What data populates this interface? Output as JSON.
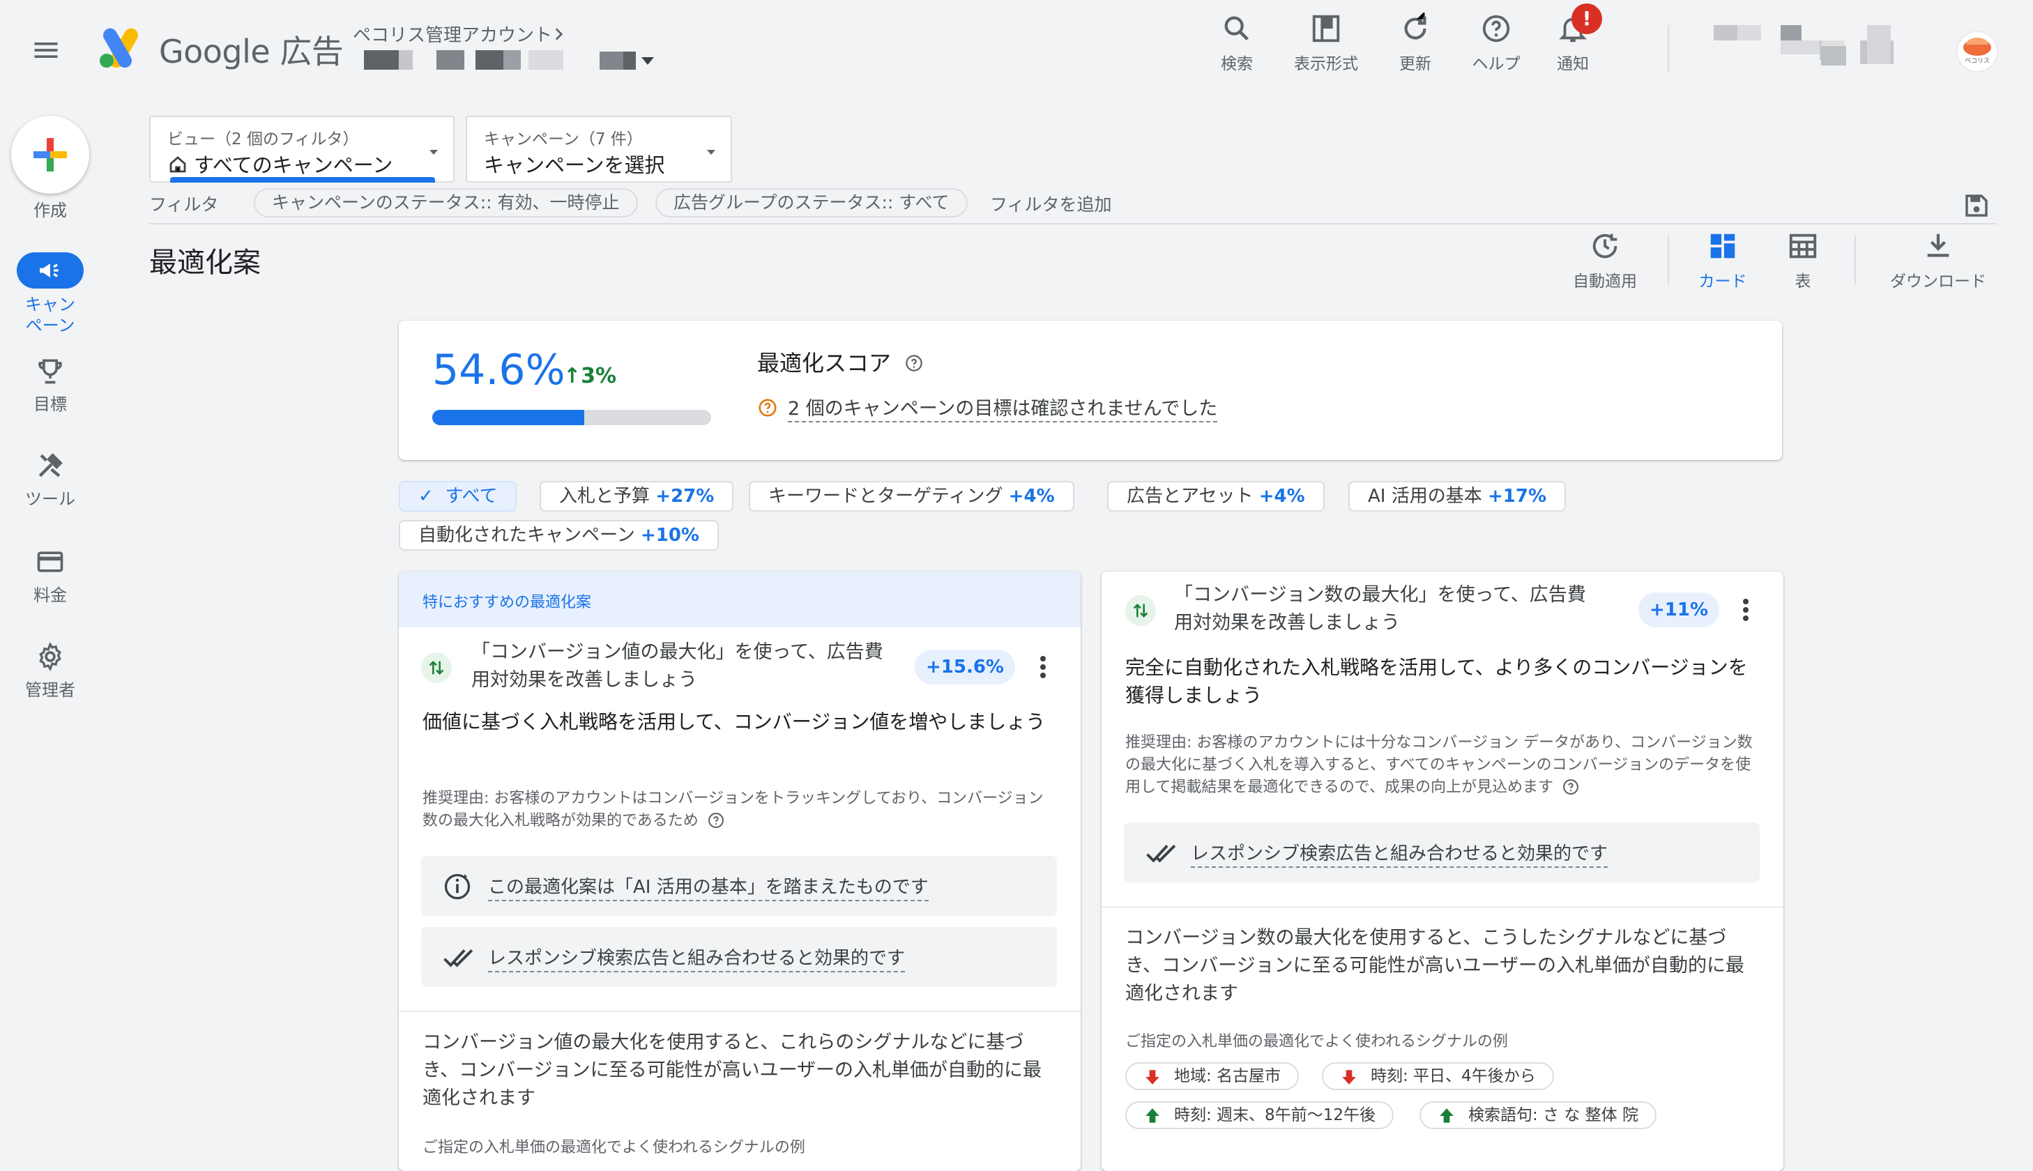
{
  "header": {
    "brand": "Google 広告",
    "account_label": "ペコリス管理アカウント",
    "tools": [
      {
        "label": "検索",
        "icon": "search-icon"
      },
      {
        "label": "表示形式",
        "icon": "appearance-icon"
      },
      {
        "label": "更新",
        "icon": "refresh-icon"
      },
      {
        "label": "ヘルプ",
        "icon": "help-icon"
      },
      {
        "label": "通知",
        "icon": "bell-icon"
      }
    ],
    "notification_badge": "!",
    "avatar_text": "ペコリス"
  },
  "sidebar": {
    "create_label": "作成",
    "items": [
      {
        "label": "キャンペーン",
        "icon": "megaphone-icon"
      },
      {
        "label": "目標",
        "icon": "trophy-icon"
      },
      {
        "label": "ツール",
        "icon": "tools-icon"
      },
      {
        "label": "料金",
        "icon": "credit-card-icon"
      },
      {
        "label": "管理者",
        "icon": "gear-icon"
      }
    ]
  },
  "selectors": {
    "view": {
      "label": "ビュー（2 個のフィルタ）",
      "value": "すべてのキャンペーン"
    },
    "campaign": {
      "label": "キャンペーン（7 件）",
      "value": "キャンペーンを選択"
    }
  },
  "filters": {
    "label": "フィルタ",
    "chips": [
      "キャンペーンのステータス:: 有効、一時停止",
      "広告グループのステータス:: すべて"
    ],
    "add": "フィルタを追加"
  },
  "page": {
    "title": "最適化案",
    "view_tools": [
      {
        "label": "自動適用",
        "icon": "auto-apply-icon"
      },
      {
        "label": "カード",
        "icon": "cards-icon"
      },
      {
        "label": "表",
        "icon": "table-icon"
      },
      {
        "label": "ダウンロード",
        "icon": "download-icon"
      }
    ]
  },
  "score": {
    "value": "54.6%",
    "delta": "3%",
    "progress": 0.546,
    "title": "最適化スコア",
    "note": "2 個のキャンペーンの目標は確認されませんでした"
  },
  "categories": [
    {
      "label": "すべて",
      "value": ""
    },
    {
      "label": "入札と予算",
      "value": "+27%"
    },
    {
      "label": "キーワードとターゲティング",
      "value": "+4%"
    },
    {
      "label": "広告とアセット",
      "value": "+4%"
    },
    {
      "label": "AI 活用の基本",
      "value": "+17%"
    },
    {
      "label": "自動化されたキャンペーン",
      "value": "+10%"
    }
  ],
  "cards": [
    {
      "featured": "特におすすめの最適化案",
      "title": "「コンバージョン値の最大化」を使って、広告費用対効果を改善しましょう",
      "badge": "+15.6%",
      "description": "価値に基づく入札戦略を活用して、コンバージョン値を増やしましょう",
      "reason": "推奨理由: お客様のアカウントはコンバージョンをトラッキングしており、コンバージョン数の最大化入札戦略が効果的であるため",
      "box1": "この最適化案は「AI 活用の基本」を踏まえたものです",
      "box2": "レスポンシブ検索広告と組み合わせると効果的です",
      "body": "コンバージョン値の最大化を使用すると、これらのシグナルなどに基づき、コンバージョンに至る可能性が高いユーザーの入札単価が自動的に最適化されます",
      "signals_label": "ご指定の入札単価の最適化でよく使われるシグナルの例"
    },
    {
      "title": "「コンバージョン数の最大化」を使って、広告費用対効果を改善しましょう",
      "badge": "+11%",
      "description": "完全に自動化された入札戦略を活用して、より多くのコンバージョンを獲得しましょう",
      "reason": "推奨理由: お客様のアカウントには十分なコンバージョン データがあり、コンバージョン数の最大化に基づく入札を導入すると、すべてのキャンペーンのコンバージョンのデータを使用して掲載結果を最適化できるので、成果の向上が見込めます",
      "box2": "レスポンシブ検索広告と組み合わせると効果的です",
      "body": "コンバージョン数の最大化を使用すると、こうしたシグナルなどに基づき、コンバージョンに至る可能性が高いユーザーの入札単価が自動的に最適化されます",
      "signals_label": "ご指定の入札単価の最適化でよく使われるシグナルの例",
      "signals": [
        {
          "text": "地域: 名古屋市",
          "dir": "down"
        },
        {
          "text": "時刻: 平日、4午後から",
          "dir": "down"
        },
        {
          "text": "時刻: 週末、8午前〜12午後",
          "dir": "up"
        },
        {
          "text": "検索語句: さ な 整体 院",
          "dir": "up"
        }
      ]
    }
  ],
  "colors": {
    "accent": "#1a73e8",
    "positive": "#188038",
    "negative": "#d93025"
  }
}
